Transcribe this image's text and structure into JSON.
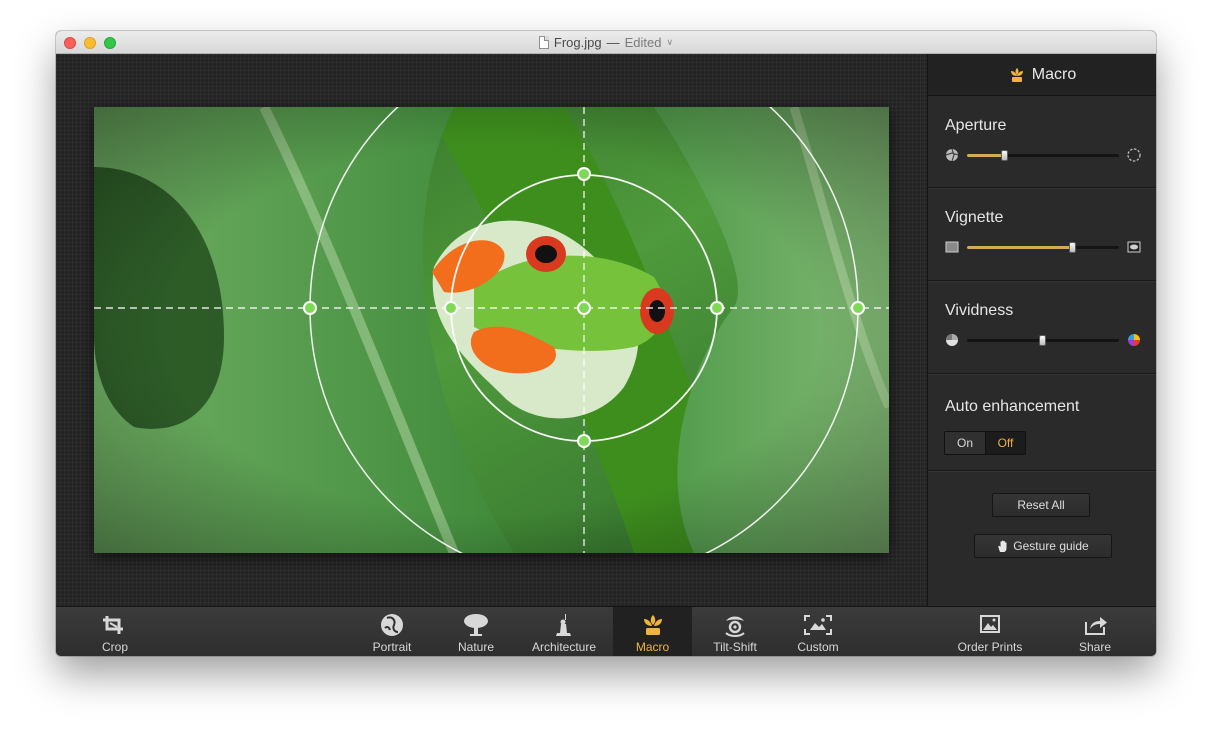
{
  "window": {
    "filename": "Frog.jpg",
    "separator": "—",
    "status": "Edited"
  },
  "panel": {
    "title": "Macro",
    "aperture": {
      "label": "Aperture",
      "value": 0.25
    },
    "vignette": {
      "label": "Vignette",
      "value": 0.7
    },
    "vividness": {
      "label": "Vividness",
      "value": 0.5
    },
    "auto_enhancement": {
      "label": "Auto enhancement",
      "options": [
        "On",
        "Off"
      ],
      "selected": "Off"
    },
    "reset_label": "Reset All",
    "gesture_label": "Gesture guide"
  },
  "toolbar": {
    "crop": "Crop",
    "portrait": "Portrait",
    "nature": "Nature",
    "architecture": "Architecture",
    "macro": "Macro",
    "tilt_shift": "Tilt-Shift",
    "custom": "Custom",
    "order_prints": "Order Prints",
    "share": "Share"
  },
  "colors": {
    "accent": "#d6a954",
    "active_tool": "#f0b43c",
    "handle": "#7ed957"
  }
}
